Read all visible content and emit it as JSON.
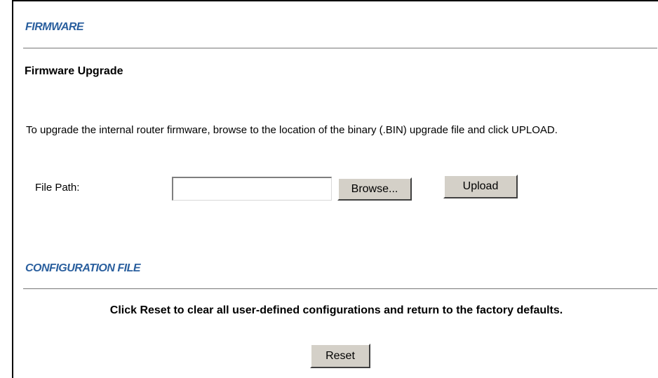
{
  "firmware": {
    "heading": "FIRMWARE",
    "subheading": "Firmware Upgrade",
    "instructions": "To upgrade the internal router firmware, browse to the location of the binary (.BIN) upgrade file and click UPLOAD.",
    "file_path_label": "File Path:",
    "file_path_value": "",
    "browse_label": "Browse...",
    "upload_label": "Upload"
  },
  "configuration": {
    "heading": "CONFIGURATION FILE",
    "message": "Click Reset to clear all user-defined configurations and return to the factory defaults.",
    "reset_label": "Reset"
  },
  "colors": {
    "heading_color": "#2a5f9e",
    "rule_color": "#8a8a8a",
    "button_face": "#d4d0c8"
  }
}
